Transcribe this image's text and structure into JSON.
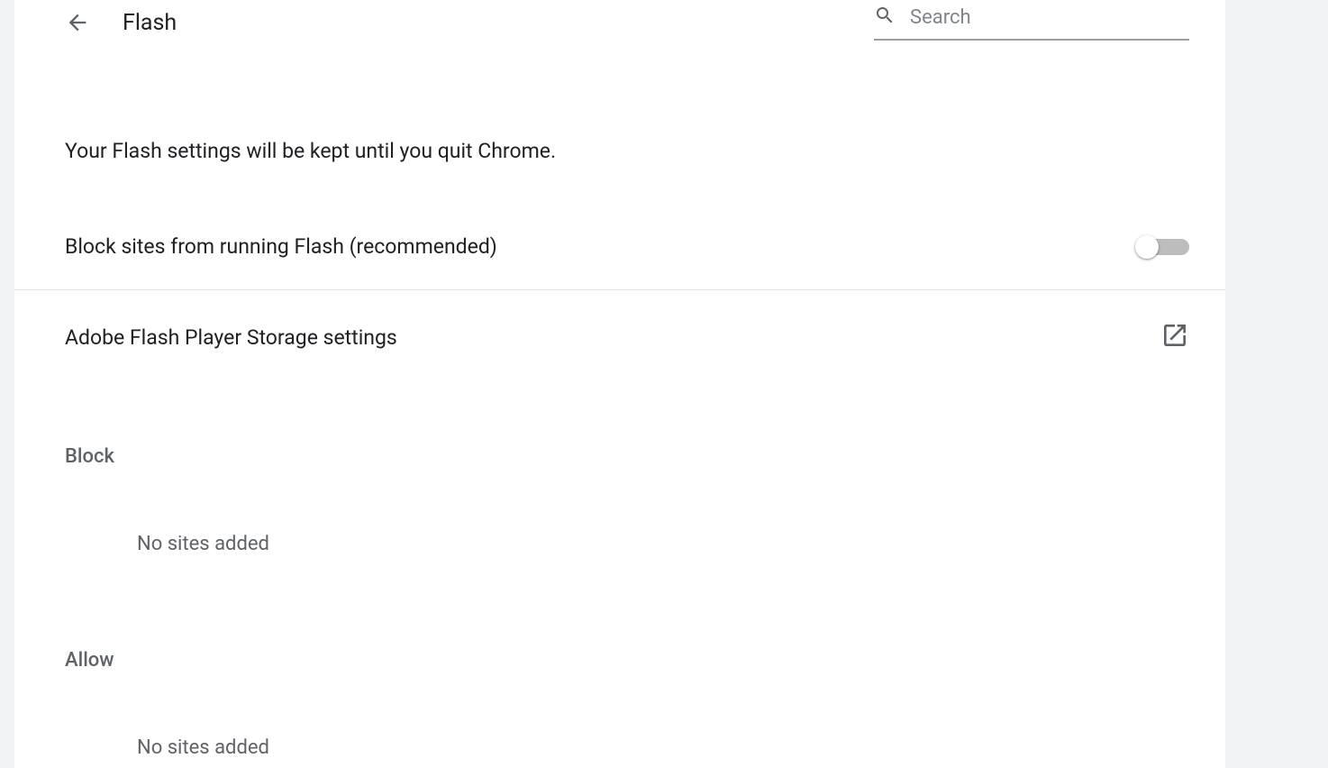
{
  "header": {
    "title": "Flash",
    "search_placeholder": "Search"
  },
  "info": {
    "message": "Your Flash settings will be kept until you quit Chrome."
  },
  "main_toggle": {
    "label": "Block sites from running Flash (recommended)",
    "enabled": false
  },
  "storage_link": {
    "label": "Adobe Flash Player Storage settings"
  },
  "sections": {
    "block": {
      "title": "Block",
      "empty": "No sites added"
    },
    "allow": {
      "title": "Allow",
      "empty": "No sites added"
    }
  }
}
